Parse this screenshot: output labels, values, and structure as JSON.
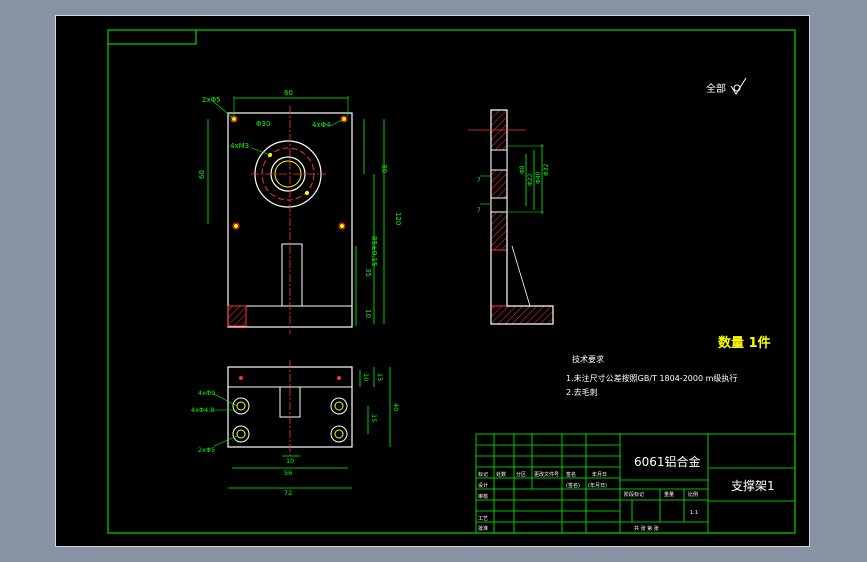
{
  "roughness_note": "全部",
  "front_dims": {
    "width_top": "60",
    "holes_top": "2xΦ5",
    "counterbore": "Φ30",
    "threads": "4xM3",
    "holes_right": "4xΦ4",
    "height_left": "60",
    "height_30": "30",
    "height_120": "120",
    "height_85": "85±0.15",
    "height_35": "35",
    "height_10": "10"
  },
  "side_dims": {
    "d1": "Φ8",
    "d2": "Φ22",
    "d3": "Φ40",
    "d4": "Φ32",
    "l1": "7",
    "l2": "7"
  },
  "top_dims": {
    "holes_a": "4xΦ9",
    "holes_b": "4xΦ4.8",
    "holes_c": "2xΦ5",
    "w_10": "10",
    "w_56": "56",
    "w_72": "72",
    "h_10": "10",
    "h_15": "15",
    "h_40": "40",
    "h_15b": "15"
  },
  "quantity": "数量  1件",
  "tech": {
    "title": "技术要求",
    "line1": "1.未注尺寸公差按照GB/T 1804-2000 m级执行",
    "line2": "2.去毛刺"
  },
  "title_block": {
    "material": "6061铝合金",
    "part_name": "支撑架1",
    "r_marker": "标记",
    "r_count": "处数",
    "r_zone": "分区",
    "r_change": "更改文件号",
    "r_sign": "签名",
    "r_date": "年月日",
    "r_design": "设计",
    "r_std": "(签名)",
    "r_date2": "(年月日)",
    "r_stage": "阶段标记",
    "r_weight": "重量",
    "r_scale": "比例",
    "r_review": "审核",
    "r_process": "工艺",
    "r_approve": "批准",
    "scale_val": "1:1",
    "sheet": "共   张   第   张"
  },
  "colors": {
    "line": "#00ff00",
    "hidden": "#ffff00",
    "accent": "#ff3030",
    "hatch": "#ff3030",
    "text": "#ffffff"
  }
}
